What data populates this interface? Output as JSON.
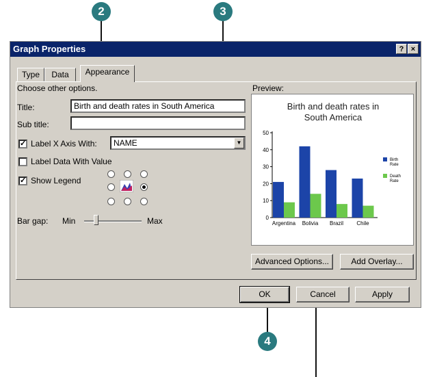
{
  "callouts": {
    "c2": "2",
    "c3": "3",
    "c4": "4"
  },
  "window": {
    "title": "Graph Properties",
    "help_glyph": "?",
    "close_glyph": "×"
  },
  "tabs": [
    "Type",
    "Data",
    "Appearance"
  ],
  "appearance": {
    "section_label": "Choose other options.",
    "title_label": "Title:",
    "title_value": "Birth and death rates in South America",
    "subtitle_label": "Sub title:",
    "subtitle_value": "",
    "label_x_axis": {
      "label": "Label X Axis With:",
      "checked": true,
      "value": "NAME"
    },
    "label_data": {
      "label": "Label Data With Value",
      "checked": false
    },
    "show_legend": {
      "label": "Show Legend",
      "checked": true
    },
    "bar_gap": {
      "label": "Bar gap:",
      "min": "Min",
      "max": "Max",
      "value_fraction": 0.2
    }
  },
  "preview": {
    "label": "Preview:",
    "title_line1": "Birth and death rates in",
    "title_line2": "South America"
  },
  "chart_data": {
    "type": "bar",
    "categories": [
      "Argentina",
      "Bolivia",
      "Brazil",
      "Chile"
    ],
    "series": [
      {
        "name": "Birth Rate",
        "values": [
          21,
          42,
          28,
          23
        ],
        "color": "#1c44a8"
      },
      {
        "name": "Death Rate",
        "values": [
          9,
          14,
          8,
          7
        ],
        "color": "#6cc84c"
      }
    ],
    "ylim": [
      0,
      50
    ],
    "yticks": [
      "50",
      "40",
      "30",
      "20",
      "10",
      "0"
    ],
    "legend": [
      "Birth Rate",
      "Death Rate"
    ]
  },
  "buttons": {
    "advanced": "Advanced Options...",
    "overlay": "Add Overlay...",
    "ok": "OK",
    "cancel": "Cancel",
    "apply": "Apply"
  }
}
